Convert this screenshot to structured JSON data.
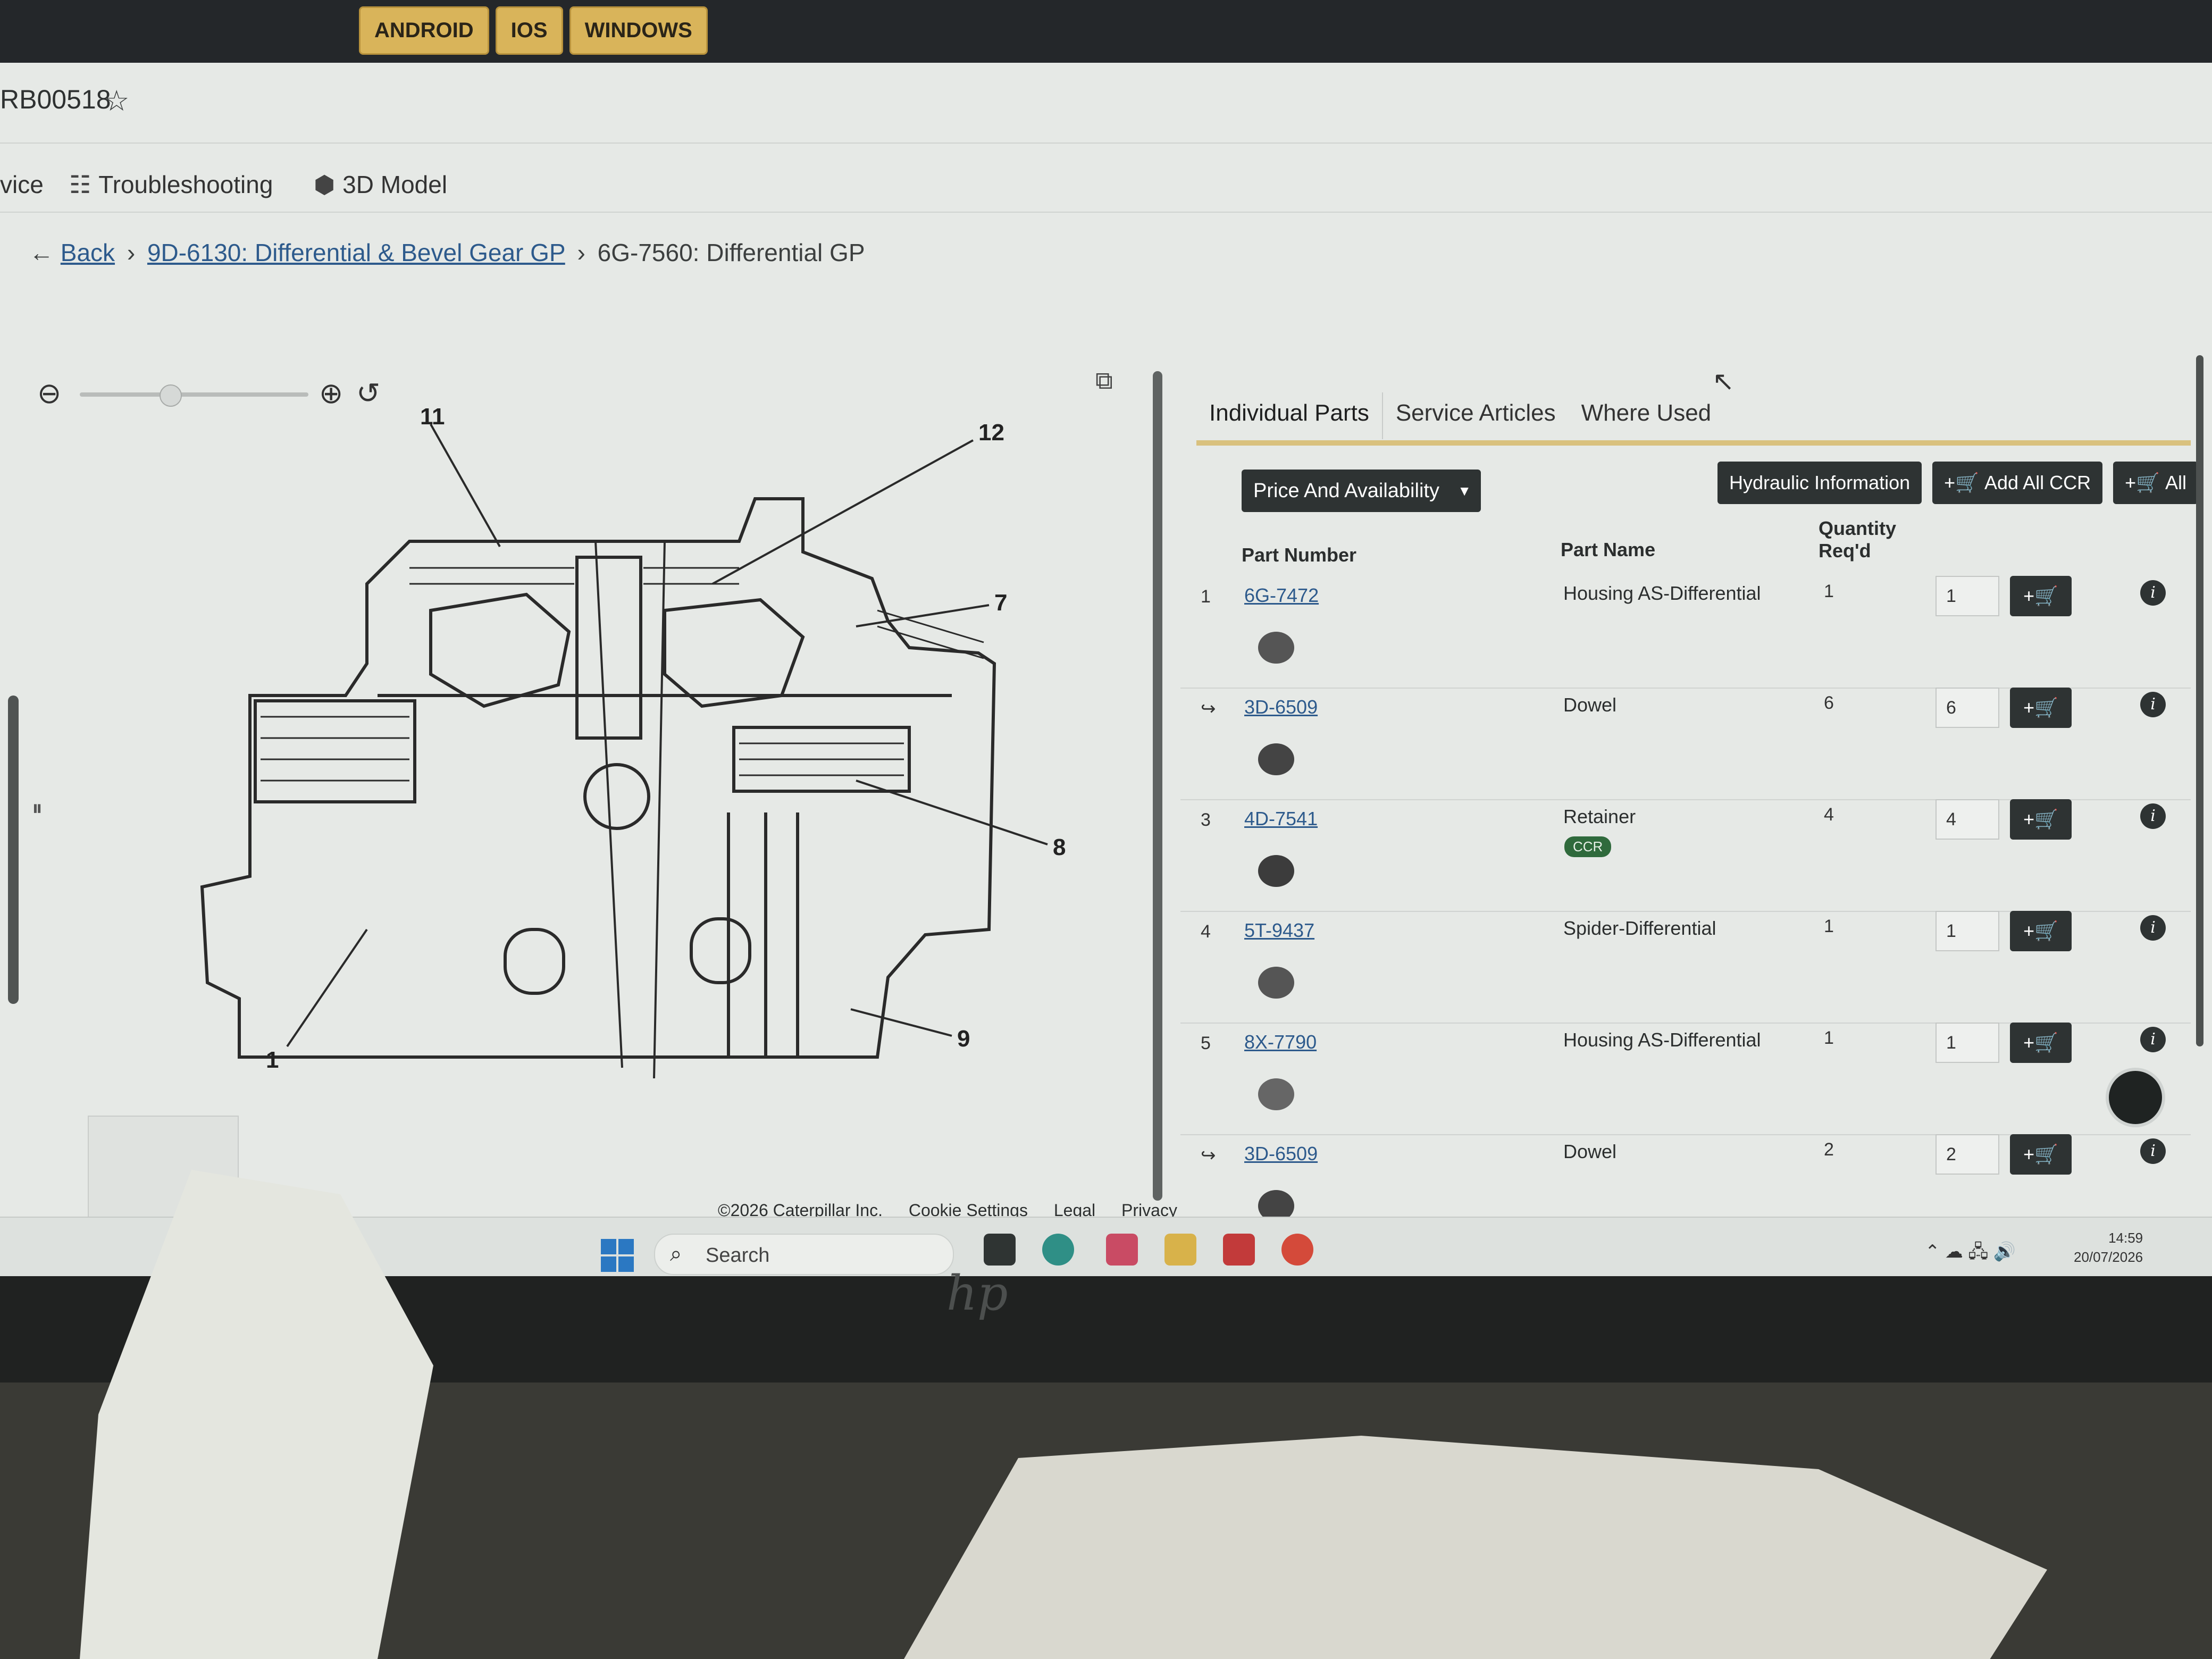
{
  "os_tabs": [
    "ANDROID",
    "IOS",
    "WINDOWS"
  ],
  "header": {
    "doc_id": "RB00518"
  },
  "nav": {
    "item_service": "vice",
    "item_troubleshooting": "Troubleshooting",
    "item_3d": "3D Model"
  },
  "breadcrumb": {
    "back": "Back",
    "parent": "9D-6130: Differential & Bevel Gear GP",
    "current": "6G-7560: Differential GP"
  },
  "drawing": {
    "callouts": [
      "11",
      "12",
      "7",
      "8",
      "9",
      "1"
    ]
  },
  "tabs": [
    "Individual Parts",
    "Service Articles",
    "Where Used"
  ],
  "toolbar": {
    "price": "Price And Availability",
    "hydraulic": "Hydraulic Information",
    "add_all_ccr": "Add All CCR",
    "all": "All"
  },
  "columns": {
    "part_number": "Part Number",
    "part_name": "Part Name",
    "quantity": "Quantity Req'd"
  },
  "parts": [
    {
      "idx": "1",
      "number": "6G-7472",
      "name": "Housing AS-Differential",
      "qty": "1",
      "input": "1"
    },
    {
      "idx": "↪",
      "number": "3D-6509",
      "name": "Dowel",
      "qty": "6",
      "input": "6"
    },
    {
      "idx": "3",
      "number": "4D-7541",
      "name": "Retainer",
      "qty": "4",
      "input": "4",
      "badge": "CCR"
    },
    {
      "idx": "4",
      "number": "5T-9437",
      "name": "Spider-Differential",
      "qty": "1",
      "input": "1"
    },
    {
      "idx": "5",
      "number": "8X-7790",
      "name": "Housing AS-Differential",
      "qty": "1",
      "input": "1"
    },
    {
      "idx": "↪",
      "number": "3D-6509",
      "name": "Dowel",
      "qty": "2",
      "input": "2"
    }
  ],
  "footer": {
    "copyright": "©2026 Caterpillar Inc.",
    "cookie": "Cookie Settings",
    "legal": "Legal",
    "privacy": "Privacy"
  },
  "taskbar": {
    "search": "Search",
    "time": "14:59",
    "date": "20/07/2026"
  },
  "icons": [
    "star-icon",
    "troubleshooting-icon",
    "cube-icon",
    "back-arrow-icon",
    "zoom-out-icon",
    "zoom-in-icon",
    "reset-icon",
    "popout-icon",
    "cart-icon",
    "info-icon",
    "windows-start-icon",
    "search-icon"
  ],
  "colors": {
    "accent_gold": "#d9c17e",
    "button_dark": "#2e3333",
    "link_blue": "#2d5a8c",
    "ccr_green": "#2f6a3c"
  }
}
